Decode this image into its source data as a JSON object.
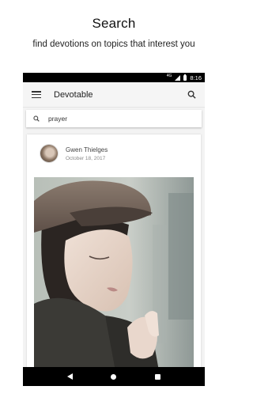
{
  "promo": {
    "headline": "Search",
    "subline": "find devotions on topics that interest you"
  },
  "statusbar": {
    "network": "4G",
    "time": "8:16"
  },
  "appbar": {
    "title": "Devotable",
    "menu_icon": "hamburger-menu-icon",
    "search_icon": "search-icon"
  },
  "search": {
    "query": "prayer",
    "icon": "search-icon"
  },
  "card": {
    "author": "Gwen Thielges",
    "date": "October 18, 2017",
    "image": "portrait photo of a woman in a newsboy cap"
  },
  "navbar": {
    "back_icon": "back-triangle-icon",
    "home_icon": "home-circle-icon",
    "recents_icon": "recents-square-icon"
  }
}
